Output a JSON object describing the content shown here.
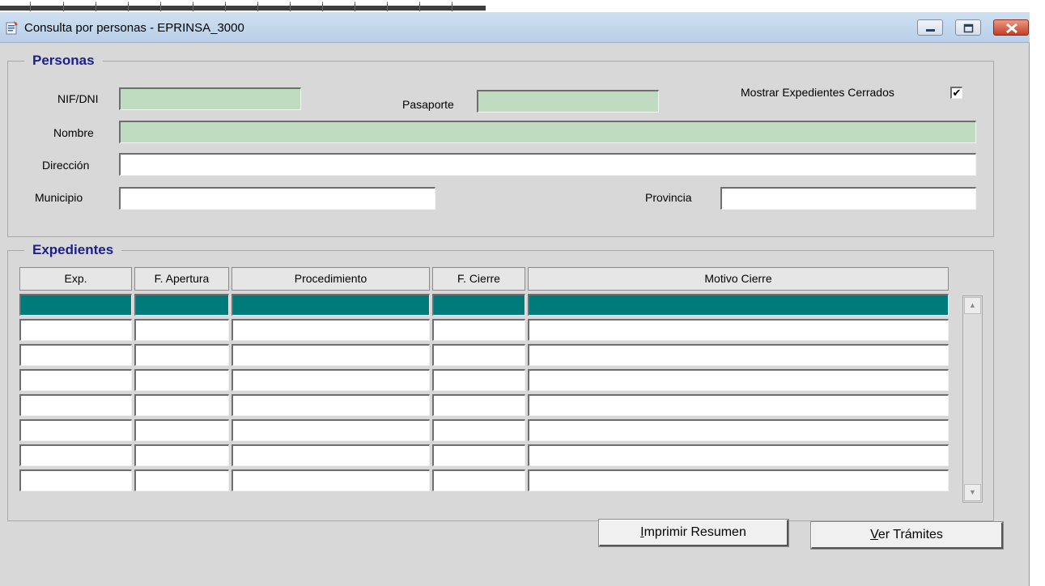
{
  "window": {
    "title": "Consulta por personas - EPRINSA_3000",
    "controls": [
      "minimize-icon",
      "maximize-icon",
      "close-icon"
    ]
  },
  "personas": {
    "legend": "Personas",
    "nif_label": "NIF/DNI",
    "nif_value": "",
    "pasaporte_label": "Pasaporte",
    "pasaporte_value": "",
    "mostrar_label": "Mostrar Expedientes Cerrados",
    "mostrar_checked": true,
    "mostrar_check_glyph": "✔",
    "nombre_label": "Nombre",
    "nombre_value": "",
    "direccion_label": "Dirección",
    "direccion_value": "",
    "municipio_label": "Municipio",
    "municipio_value": "",
    "provincia_label": "Provincia",
    "provincia_value": ""
  },
  "expedientes": {
    "legend": "Expedientes",
    "columns": [
      "Exp.",
      "F. Apertura",
      "Procedimiento",
      "F. Cierre",
      "Motivo Cierre"
    ],
    "rows": [
      [
        "",
        "",
        "",
        "",
        ""
      ],
      [
        "",
        "",
        "",
        "",
        ""
      ],
      [
        "",
        "",
        "",
        "",
        ""
      ],
      [
        "",
        "",
        "",
        "",
        ""
      ],
      [
        "",
        "",
        "",
        "",
        ""
      ],
      [
        "",
        "",
        "",
        "",
        ""
      ],
      [
        "",
        "",
        "",
        "",
        ""
      ],
      [
        "",
        "",
        "",
        "",
        ""
      ]
    ],
    "selected_row": 0
  },
  "buttons": {
    "imprimir": {
      "mnemonic": "I",
      "rest": "mprimir Resumen"
    },
    "ver": {
      "mnemonic": "V",
      "rest": "er Trámites"
    }
  },
  "colors": {
    "selected_row": "#007b7b",
    "readonly_field": "#c0dcc0",
    "group_title": "#1a1f8c",
    "window_bg": "#d8d8d8"
  }
}
